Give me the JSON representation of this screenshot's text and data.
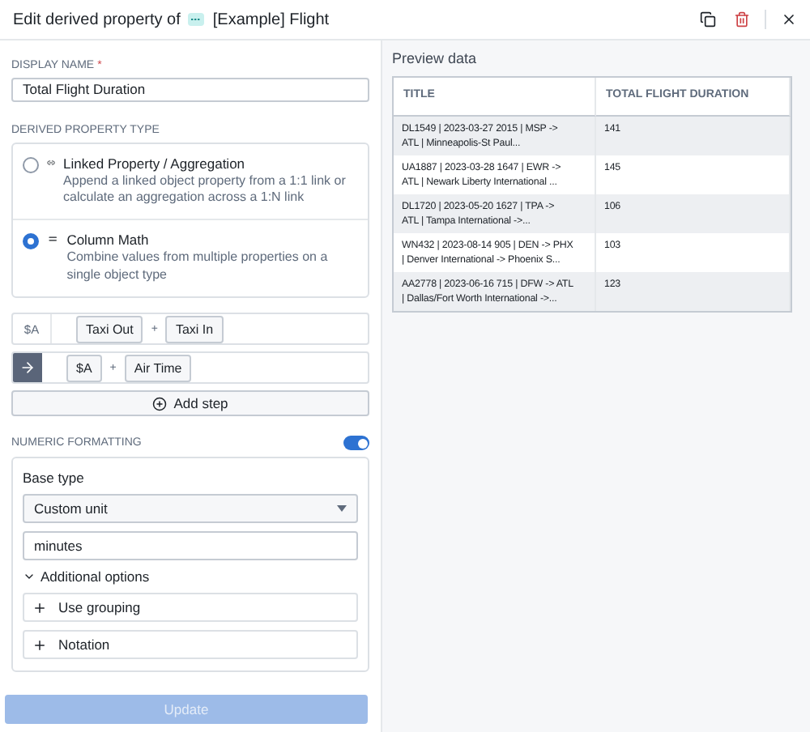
{
  "header": {
    "title": "Edit derived property of",
    "object": "[Example] Flight"
  },
  "display_name": {
    "label": "DISPLAY NAME",
    "required": "*",
    "value": "Total Flight Duration"
  },
  "type_section": {
    "label": "DERIVED PROPERTY TYPE",
    "options": [
      {
        "kind": "link",
        "title": "Linked Property / Aggregation",
        "description": "Append a linked object property from a 1:1 link or calculate an aggregation across a 1:N link",
        "selected": false
      },
      {
        "kind": "math",
        "title": "Column Math",
        "description": "Combine values from multiple properties on a single object type",
        "selected": true
      }
    ]
  },
  "steps": [
    {
      "kind": "variable",
      "label": "$A",
      "operands": [
        "Taxi Out",
        "Taxi In"
      ],
      "operator": "+"
    },
    {
      "kind": "result",
      "operands": [
        "$A",
        "Air Time"
      ],
      "operator": "+"
    }
  ],
  "add_step": "Add step",
  "numeric_formatting": {
    "label": "NUMERIC FORMATTING",
    "on": true,
    "base_type_label": "Base type",
    "base_type": "Custom unit",
    "unit": "minutes",
    "additional_options": "Additional options",
    "expanded": true,
    "options": [
      "Use grouping",
      "Notation"
    ]
  },
  "update_button": {
    "label": "Update",
    "disabled": true
  },
  "preview": {
    "title": "Preview data",
    "columns": [
      "TITLE",
      "TOTAL FLIGHT DURATION"
    ],
    "rows": [
      [
        "DL1549 | 2023-03-27 2015 | MSP ->\nATL | Minneapolis-St Paul...",
        "141"
      ],
      [
        "UA1887 | 2023-03-28 1647 | EWR ->\nATL | Newark Liberty International ...",
        "145"
      ],
      [
        "DL1720 | 2023-05-20 1627 | TPA ->\nATL | Tampa International ->...",
        "106"
      ],
      [
        "WN432 | 2023-08-14 905 | DEN -> PHX\n| Denver International -> Phoenix S...",
        "103"
      ],
      [
        "AA2778 | 2023-06-16 715 | DFW -> ATL\n| Dallas/Fort Worth International ->...",
        "123"
      ]
    ]
  }
}
